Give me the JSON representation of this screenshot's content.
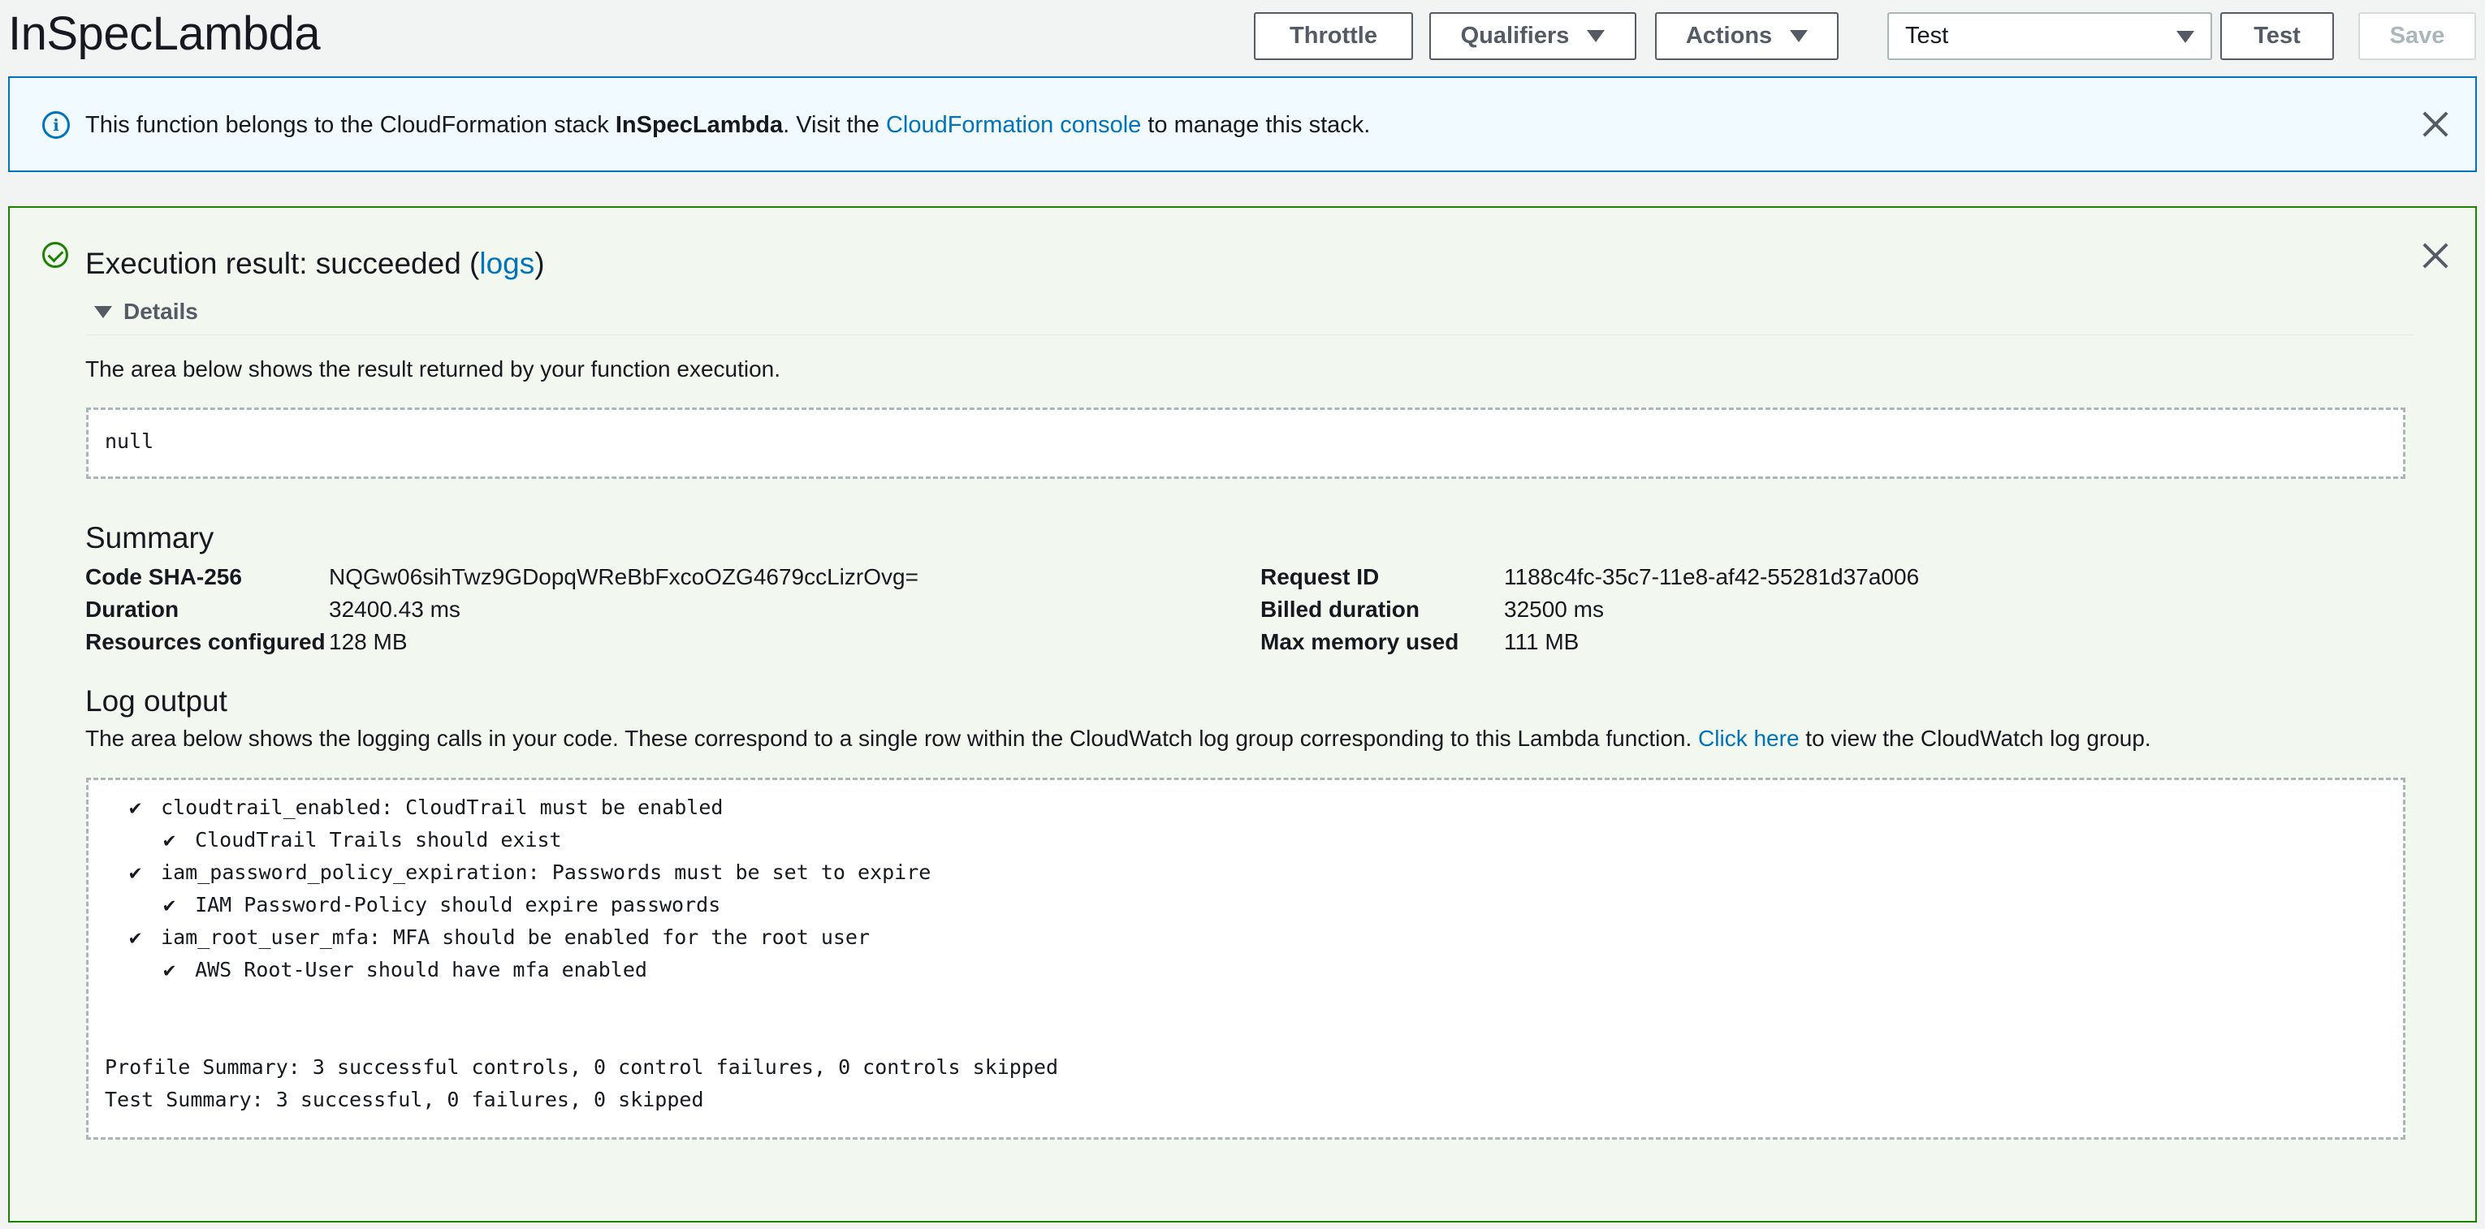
{
  "header": {
    "function_name": "InSpecLambda",
    "buttons": {
      "throttle": "Throttle",
      "qualifiers": "Qualifiers",
      "actions": "Actions",
      "test": "Test",
      "save": "Save"
    },
    "test_event_selected": "Test"
  },
  "info_banner": {
    "text_before": "This function belongs to the CloudFormation stack ",
    "stack_name": "InSpecLambda",
    "text_middle": ". Visit the ",
    "console_link": "CloudFormation console",
    "text_after": " to manage this stack."
  },
  "execution_result": {
    "title_prefix": "Execution result: succeeded (",
    "logs_link": "logs",
    "title_suffix": ")",
    "details_label": "Details",
    "result_description": "The area below shows the result returned by your function execution.",
    "result_value": "null",
    "summary": {
      "title": "Summary",
      "left": [
        {
          "label": "Code SHA-256",
          "value": "NQGw06sihTwz9GDopqWReBbFxcoOZG4679ccLizrOvg="
        },
        {
          "label": "Duration",
          "value": "32400.43 ms"
        },
        {
          "label": "Resources configured",
          "value": "128 MB"
        }
      ],
      "right": [
        {
          "label": "Request ID",
          "value": "1188c4fc-35c7-11e8-af42-55281d37a006"
        },
        {
          "label": "Billed duration",
          "value": "32500 ms"
        },
        {
          "label": "Max memory used",
          "value": "111 MB"
        }
      ]
    },
    "log_output": {
      "title": "Log output",
      "description_before": "The area below shows the logging calls in your code. These correspond to a single row within the CloudWatch log group corresponding to this Lambda function. ",
      "click_here_link": "Click here",
      "description_after": " to view the CloudWatch log group.",
      "check_mark": "✔",
      "lines": [
        "cloudtrail_enabled: CloudTrail must be enabled",
        "CloudTrail Trails should exist",
        "iam_password_policy_expiration: Passwords must be set to expire",
        "IAM Password-Policy should expire passwords",
        "iam_root_user_mfa: MFA should be enabled for the root user",
        "AWS Root-User should have mfa enabled"
      ],
      "profile_summary": "Profile Summary: 3 successful controls, 0 control failures, 0 controls skipped",
      "test_summary": "Test Summary: 3 successful, 0 failures, 0 skipped"
    }
  }
}
